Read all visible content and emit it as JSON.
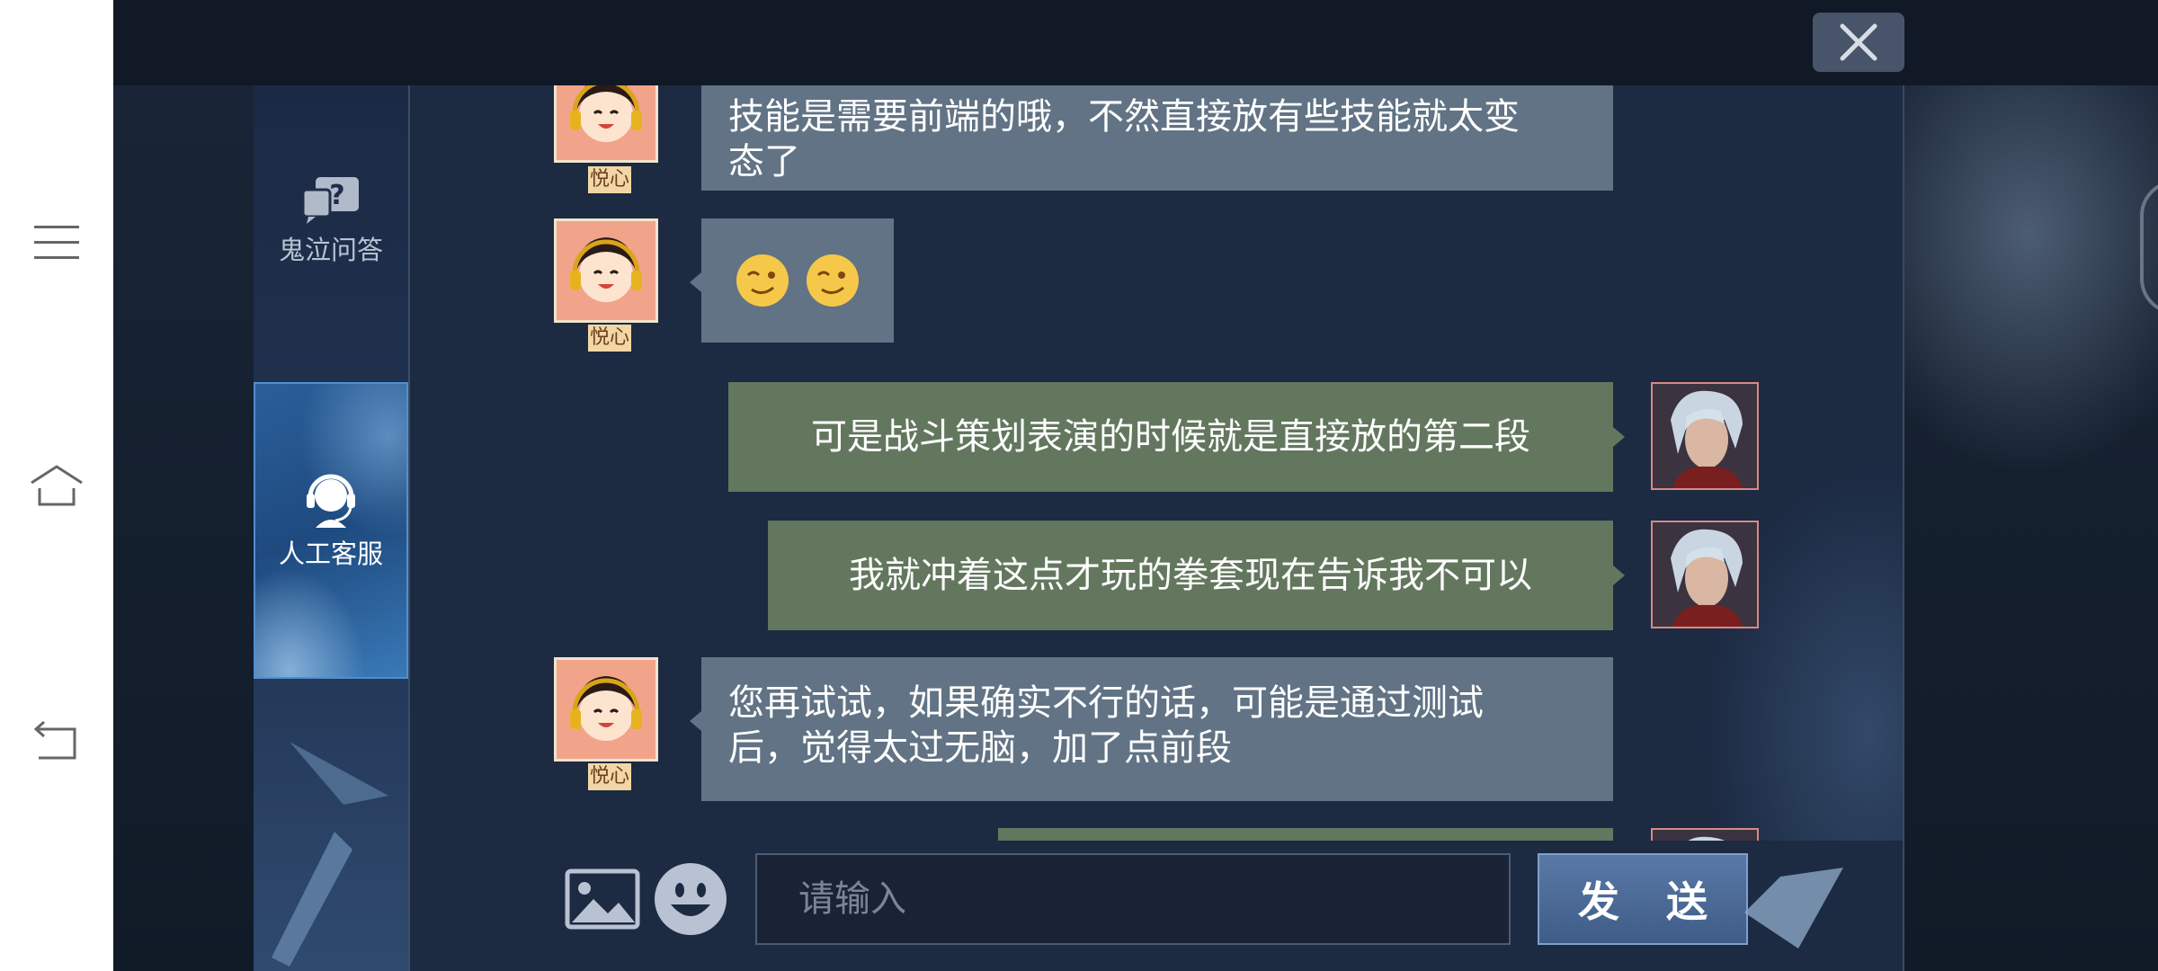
{
  "nav": {
    "buttons": [
      {
        "name": "menu-icon"
      },
      {
        "name": "home-icon"
      },
      {
        "name": "back-icon"
      }
    ]
  },
  "sidebar": {
    "items": [
      {
        "label": "鬼泣问答",
        "icon": "question-chat-icon",
        "active": false
      },
      {
        "label": "人工客服",
        "icon": "headset-icon",
        "active": true
      }
    ]
  },
  "chat": {
    "messages": [
      {
        "from": "agent",
        "sender_name": "悦心",
        "text": "技能是需要前端的哦，不然直接放有些技能就太变态了",
        "lines": [
          "技能是需要前端的哦，不然直接放有些技能就太变",
          "态了"
        ]
      },
      {
        "from": "agent",
        "sender_name": "悦心",
        "emoji": "😉😉"
      },
      {
        "from": "user",
        "text": "可是战斗策划表演的时候就是直接放的第二段"
      },
      {
        "from": "user",
        "text": "我就冲着这点才玩的拳套现在告诉我不可以"
      },
      {
        "from": "agent",
        "sender_name": "悦心",
        "text": "您再试试，如果确实不行的话，可能是通过测试后，觉得太过无脑，加了点前段",
        "lines": [
          "您再试试，如果确实不行的话，可能是通过测试",
          "后，觉得太过无脑，加了点前段"
        ]
      },
      {
        "from": "user",
        "text": ""
      }
    ]
  },
  "composer": {
    "image_icon": "image-icon",
    "emoji_icon": "emoji-icon",
    "placeholder": "请输入",
    "send_label": "发 送"
  },
  "close_icon": "close-icon",
  "colors": {
    "agent_bubble": "#617384",
    "user_bubble": "#63775e",
    "send_button": "#4a6896"
  }
}
